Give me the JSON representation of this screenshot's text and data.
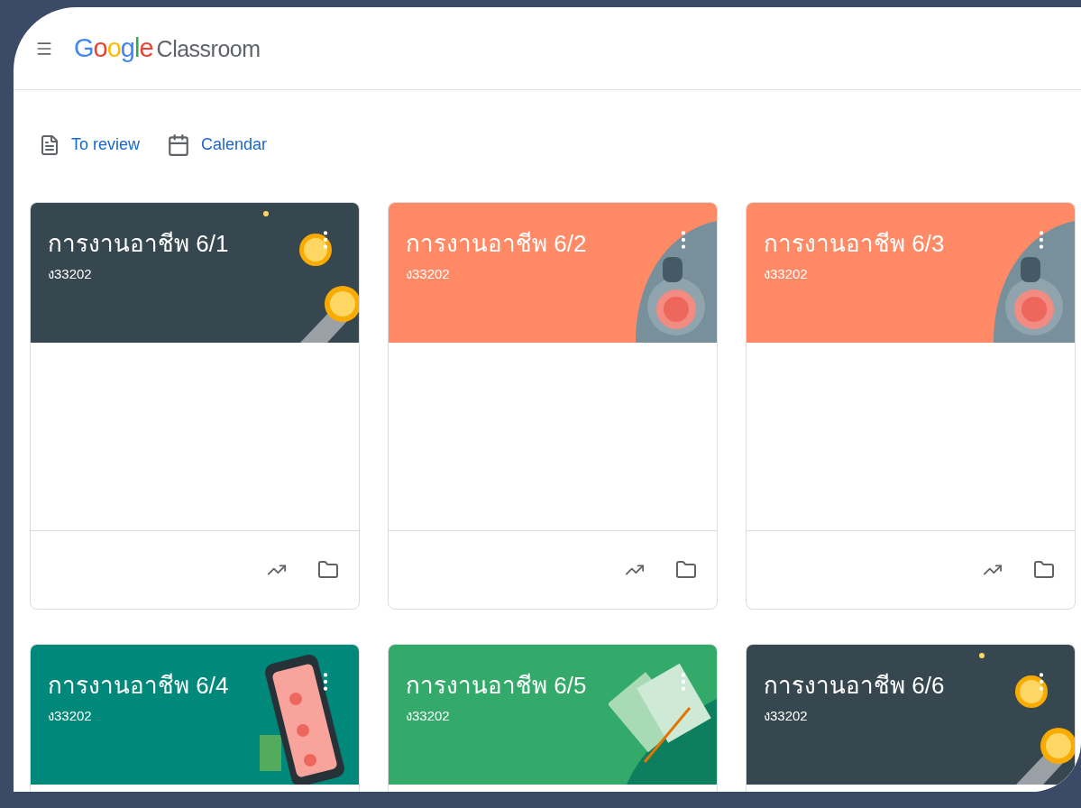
{
  "header": {
    "logo": "Google",
    "product": "Classroom"
  },
  "toolbar": [
    {
      "kind": "review",
      "label": "To review"
    },
    {
      "kind": "calendar",
      "label": "Calendar"
    }
  ],
  "classes": [
    {
      "title": "การงานอาชีพ 6/1",
      "code": "ง33202",
      "color": "#37474f",
      "kind": "coins"
    },
    {
      "title": "การงานอาชีพ 6/2",
      "code": "ง33202",
      "color": "#ff8a65",
      "kind": "cup"
    },
    {
      "title": "การงานอาชีพ 6/3",
      "code": "ง33202",
      "color": "#ff8a65",
      "kind": "cup"
    },
    {
      "title": "การงานอาชีพ 6/4",
      "code": "ง33202",
      "color": "#00897b",
      "kind": "phone"
    },
    {
      "title": "การงานอาชีพ 6/5",
      "code": "ง33202",
      "color": "#33a96a",
      "kind": "book"
    },
    {
      "title": "การงานอาชีพ 6/6",
      "code": "ง33202",
      "color": "#37474f",
      "kind": "coins"
    }
  ]
}
